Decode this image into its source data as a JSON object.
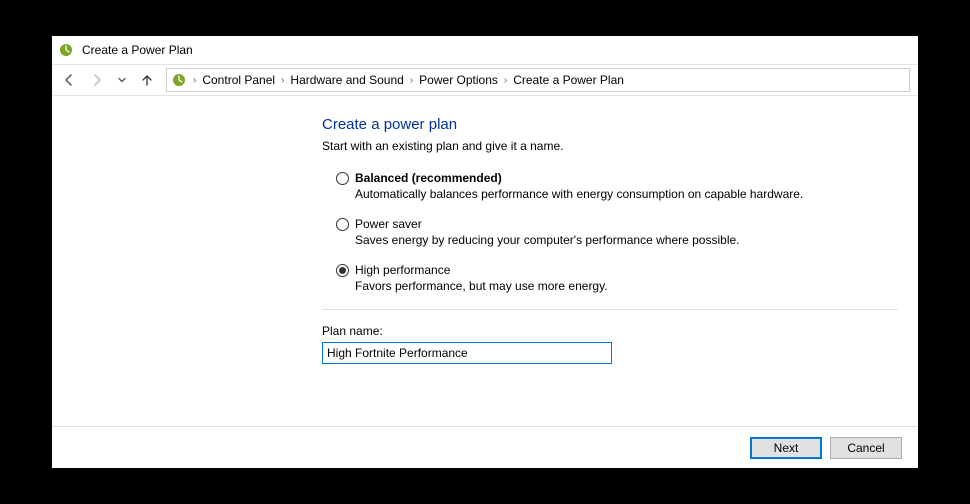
{
  "window": {
    "title": "Create a Power Plan"
  },
  "breadcrumb": {
    "items": [
      "Control Panel",
      "Hardware and Sound",
      "Power Options",
      "Create a Power Plan"
    ]
  },
  "page": {
    "title": "Create a power plan",
    "subtitle": "Start with an existing plan and give it a name."
  },
  "plans": [
    {
      "label": "Balanced (recommended)",
      "desc": "Automatically balances performance with energy consumption on capable hardware.",
      "bold": true,
      "selected": false
    },
    {
      "label": "Power saver",
      "desc": "Saves energy by reducing your computer's performance where possible.",
      "bold": false,
      "selected": false
    },
    {
      "label": "High performance",
      "desc": "Favors performance, but may use more energy.",
      "bold": false,
      "selected": true
    }
  ],
  "name_section": {
    "label": "Plan name:",
    "value": "High Fortnite Performance"
  },
  "footer": {
    "next": "Next",
    "cancel": "Cancel"
  }
}
